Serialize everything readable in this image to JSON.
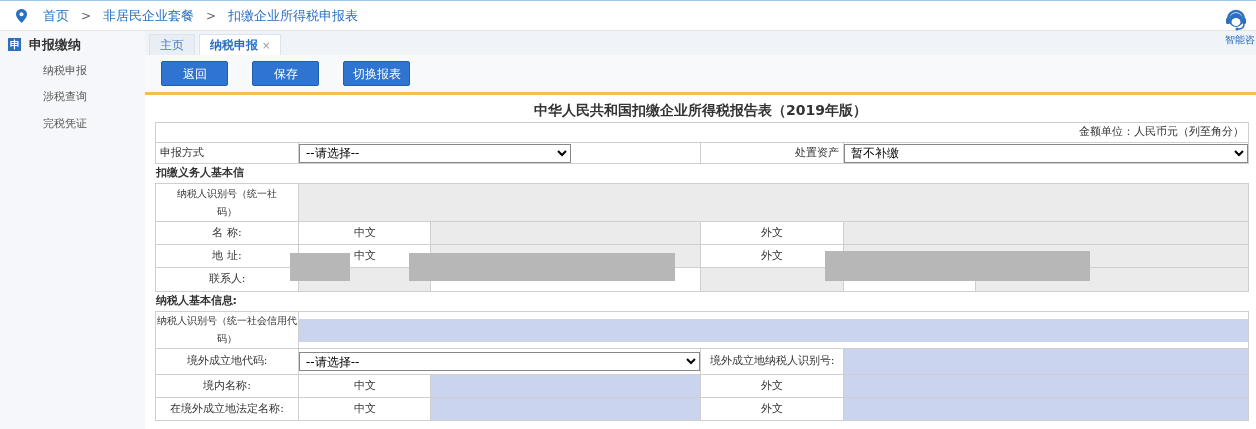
{
  "breadcrumb": [
    {
      "label": "首页"
    },
    {
      "label": "非居民企业套餐"
    },
    {
      "label": "扣缴企业所得税申报表"
    }
  ],
  "breadcrumb_separator": ">",
  "assistant": {
    "label": "智能咨"
  },
  "sidebar": {
    "icon_char": "申",
    "title": "申报缴纳",
    "items": [
      {
        "label": "纳税申报"
      },
      {
        "label": "涉税查询"
      },
      {
        "label": "完税凭证"
      }
    ]
  },
  "tabs": [
    {
      "label": "主页",
      "selected": false
    },
    {
      "label": "纳税申报",
      "selected": true,
      "close": "×"
    }
  ],
  "toolbar": [
    "返回",
    "保存",
    "切换报表"
  ],
  "form": {
    "title": "中华人民共和国扣缴企业所得税报告表（2019年版）",
    "unit_note": "金额单位：人民币元（列至角分）",
    "filing_method": {
      "label": "申报方式",
      "value": "--请选择--"
    },
    "asset_disposal": {
      "label": "处置资产",
      "value": "暂不补缴"
    },
    "withholder": {
      "heading": "扣缴义务人基本信",
      "id_label_lines": [
        "纳税人识别号（统一社",
        "码）"
      ],
      "rows": [
        {
          "label": "名 称:",
          "cn": "中文",
          "foreign": "外文"
        },
        {
          "label": "地 址:",
          "cn": "中文",
          "foreign": "外文"
        }
      ],
      "contact_label": "联系人:"
    },
    "taxpayer": {
      "heading": "纳税人基本信息:",
      "id_label_lines": [
        "纳税人识别号（统一社会信用代",
        "码）"
      ],
      "country_label": "境外成立地代码:",
      "country_value": "--请选择--",
      "foreign_id_label": "境外成立地纳税人识别号:",
      "rows": [
        {
          "label": "境内名称:",
          "cn": "中文",
          "foreign": "外文"
        },
        {
          "label": "在境外成立地法定名称:",
          "cn": "中文",
          "foreign": "外文"
        }
      ]
    }
  }
}
